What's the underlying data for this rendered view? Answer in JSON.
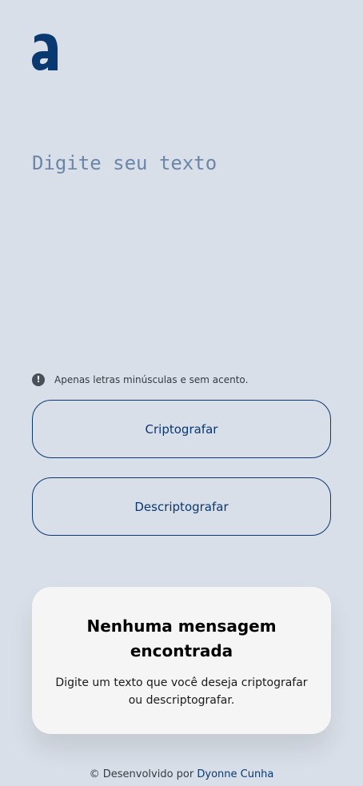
{
  "logo": {
    "icon": "alura-a-logo-icon",
    "color": "#0a3871"
  },
  "input": {
    "placeholder": "Digite seu texto",
    "value": ""
  },
  "hint": {
    "icon": "exclamation-icon",
    "text": "Apenas letras minúsculas e sem acento."
  },
  "buttons": {
    "encrypt_label": "Criptografar",
    "decrypt_label": "Descriptografar"
  },
  "output": {
    "title": "Nenhuma mensagem encontrada",
    "message": "Digite um texto que você deseja criptografar ou descriptografar."
  },
  "footer": {
    "prefix": "© Desenvolvido por",
    "author": "Dyonne Cunha"
  },
  "colors": {
    "background": "#d9dfe8",
    "accent": "#0a3871",
    "card": "#f5f5f5"
  }
}
